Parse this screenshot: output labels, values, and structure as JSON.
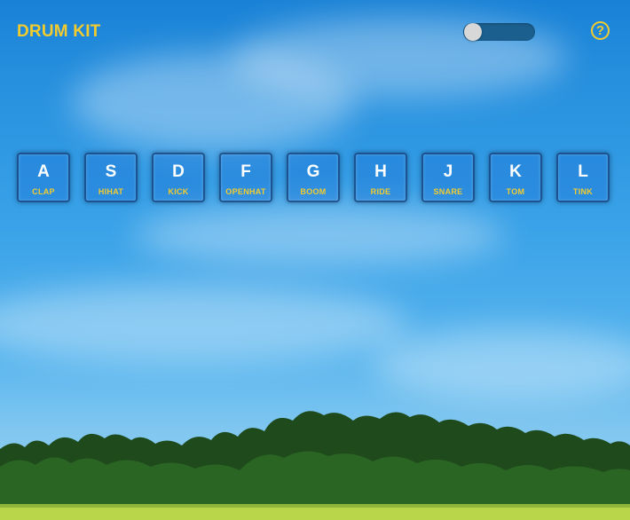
{
  "header": {
    "title": "DRUM KIT",
    "help_label": "?"
  },
  "toggle": {
    "state": "off"
  },
  "keys": [
    {
      "letter": "A",
      "sound": "CLAP"
    },
    {
      "letter": "S",
      "sound": "HIHAT"
    },
    {
      "letter": "D",
      "sound": "KICK"
    },
    {
      "letter": "F",
      "sound": "OPENHAT"
    },
    {
      "letter": "G",
      "sound": "BOOM"
    },
    {
      "letter": "H",
      "sound": "RIDE"
    },
    {
      "letter": "J",
      "sound": "SNARE"
    },
    {
      "letter": "K",
      "sound": "TOM"
    },
    {
      "letter": "L",
      "sound": "TINK"
    }
  ],
  "colors": {
    "accent": "#f2cc2f",
    "sky_top": "#1a82d6",
    "sky_bottom": "#a3d6f2",
    "toggle_track": "#1a5f8e"
  },
  "icons": [
    "help-icon"
  ]
}
